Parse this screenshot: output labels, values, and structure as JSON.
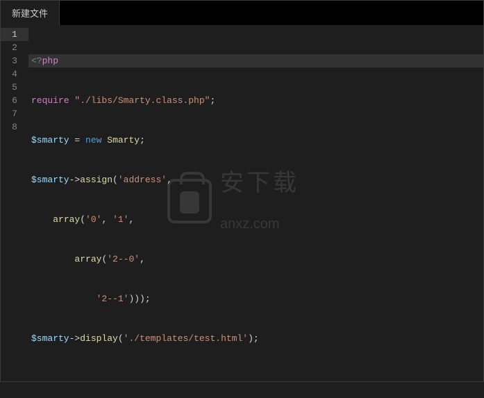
{
  "tab": {
    "label": "新建文件"
  },
  "gutter": {
    "lines": [
      "1",
      "2",
      "3",
      "4",
      "5",
      "6",
      "7",
      "8"
    ]
  },
  "activeLine": 0,
  "code": {
    "l1": {
      "open": "<?",
      "php": "php"
    },
    "l2": {
      "req": "require",
      "sp": " ",
      "str": "\"./libs/Smarty.class.php\"",
      "semi": ";"
    },
    "l3": {
      "var": "$smarty",
      "sp1": " ",
      "eq": "=",
      "sp2": " ",
      "new": "new",
      "sp3": " ",
      "cls": "Smarty",
      "semi": ";"
    },
    "l4": {
      "var": "$smarty",
      "arrow": "->",
      "fn": "assign",
      "open": "(",
      "str": "'address'",
      "comma": ","
    },
    "l5": {
      "indent": "    ",
      "fn": "array",
      "open": "(",
      "s1": "'0'",
      "c1": ",",
      "sp": " ",
      "s2": "'1'",
      "comma": ","
    },
    "l6": {
      "indent": "        ",
      "fn": "array",
      "open": "(",
      "s1": "'2--0'",
      "comma": ","
    },
    "l7": {
      "indent": "            ",
      "s1": "'2--1'",
      "close": ")));"
    },
    "l8": {
      "var": "$smarty",
      "arrow": "->",
      "fn": "display",
      "open": "(",
      "str": "'./templates/test.html'",
      "close": ");"
    }
  },
  "watermark": {
    "cn": "安下载",
    "en": "anxz.com"
  }
}
